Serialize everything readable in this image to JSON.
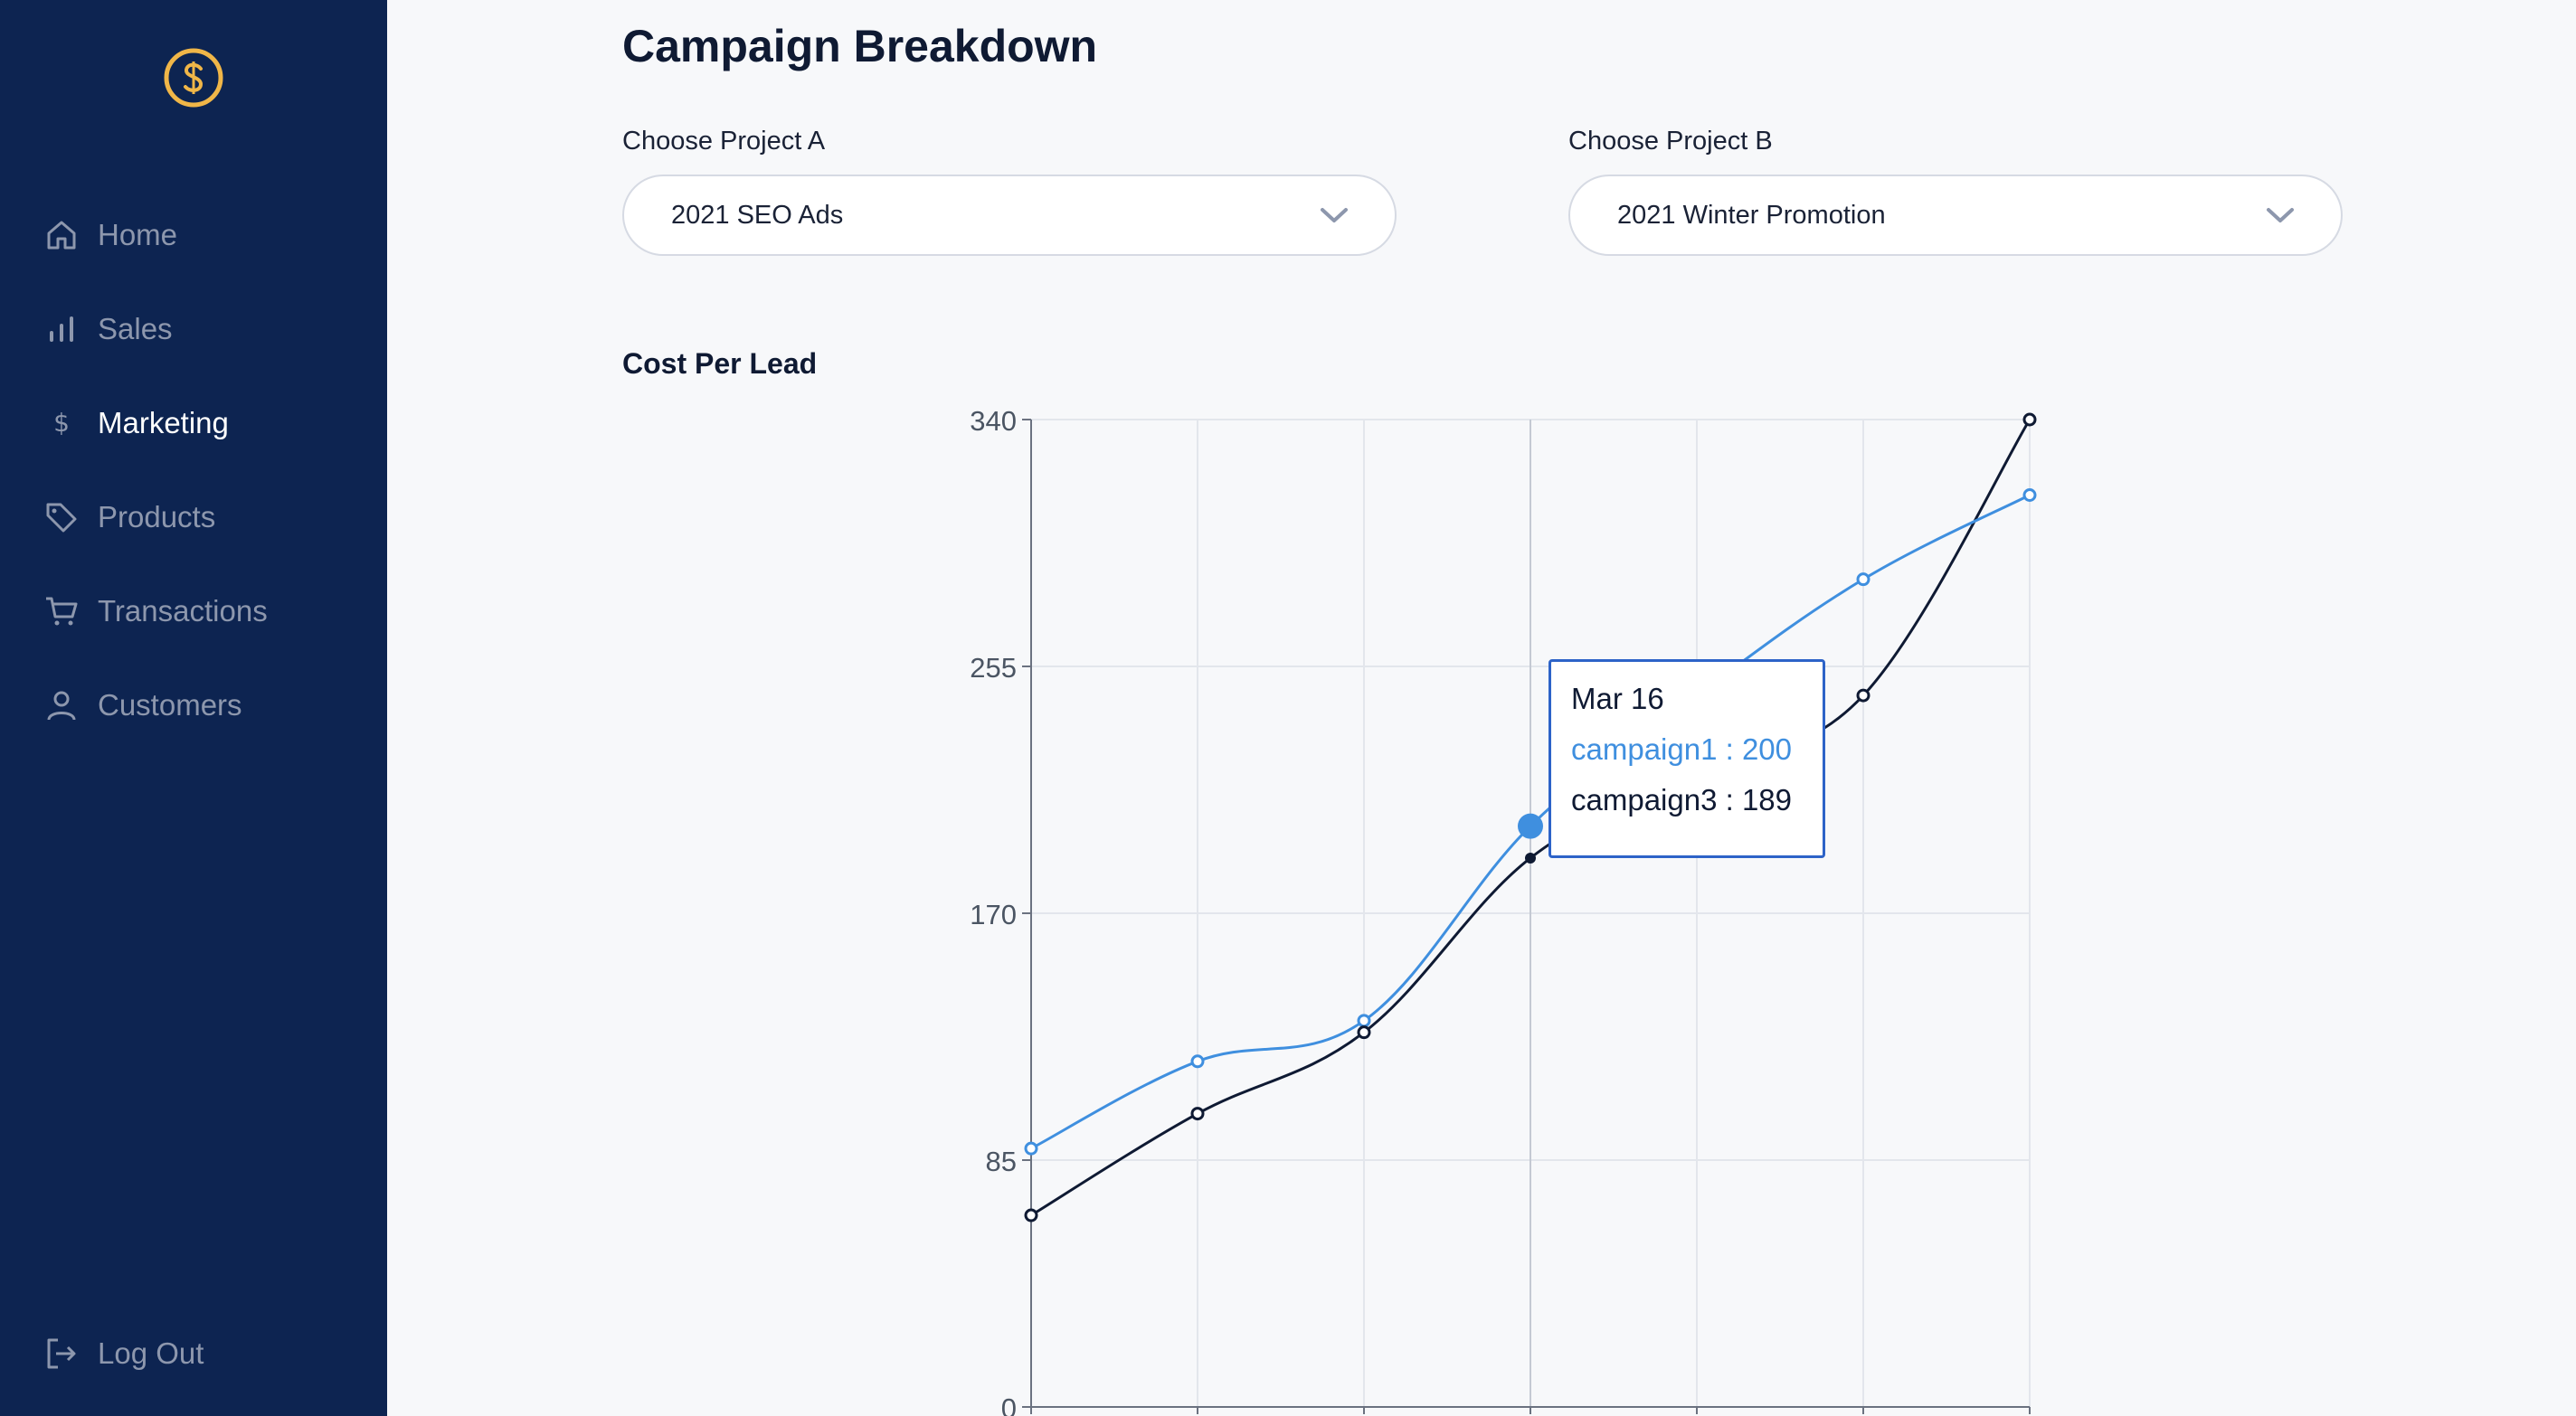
{
  "sidebar": {
    "items": [
      {
        "label": "Home",
        "icon": "home-icon",
        "active": false
      },
      {
        "label": "Sales",
        "icon": "bar-chart-icon",
        "active": false
      },
      {
        "label": "Marketing",
        "icon": "dollar-icon",
        "active": true
      },
      {
        "label": "Products",
        "icon": "tag-icon",
        "active": false
      },
      {
        "label": "Transactions",
        "icon": "cart-icon",
        "active": false
      },
      {
        "label": "Customers",
        "icon": "user-icon",
        "active": false
      }
    ],
    "logout": {
      "label": "Log Out",
      "icon": "logout-icon"
    },
    "logo_icon": "brand-logo-icon"
  },
  "colors": {
    "sidebar_bg": "#0d2451",
    "accent_gold": "#f0b648",
    "series1": "#3f8fdf",
    "series2": "#0f1a33"
  },
  "main": {
    "title": "Campaign Breakdown",
    "project_a": {
      "label": "Choose Project A",
      "value": "2021 SEO Ads"
    },
    "project_b": {
      "label": "Choose Project B",
      "value": "2021 Winter Promotion"
    },
    "chart_title": "Cost Per Lead"
  },
  "tooltip": {
    "date": "Mar 16",
    "row1": "campaign1 : 200",
    "row2": "campaign3 : 189"
  },
  "chart_data": {
    "type": "line",
    "title": "Cost Per Lead",
    "y_ticks": [
      "340",
      "255",
      "170",
      "85",
      "0"
    ],
    "ylim": [
      0,
      340
    ],
    "grid": true,
    "hover_index": 3,
    "series": [
      {
        "name": "campaign1",
        "color": "#3f8fdf",
        "values": [
          89,
          119,
          133,
          200,
          245,
          285,
          314
        ]
      },
      {
        "name": "campaign3",
        "color": "#0f1a33",
        "values": [
          66,
          101,
          129,
          189,
          218,
          245,
          340
        ]
      }
    ]
  }
}
